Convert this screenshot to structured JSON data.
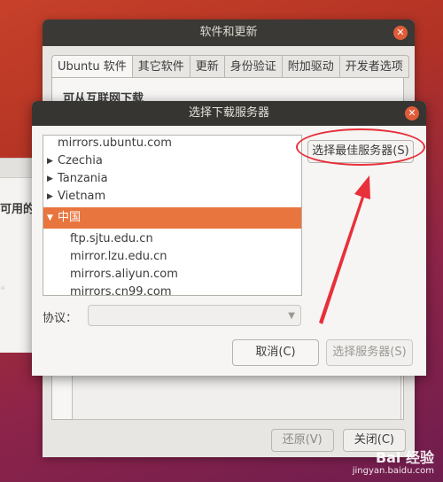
{
  "background_window": {
    "title": "软件和更新",
    "tabs": [
      "Ubuntu 软件",
      "其它软件",
      "更新",
      "身份验证",
      "附加驱动",
      "开发者选项"
    ],
    "section_title": "可从互联网下载",
    "buttons": {
      "revert": "还原(V)",
      "close": "关闭(C)"
    }
  },
  "left_window": {
    "partial_text": "可用的"
  },
  "dialog": {
    "title": "选择下载服务器",
    "list": {
      "top_item": "mirrors.ubuntu.com",
      "countries": [
        "Czechia",
        "Tanzania",
        "Vietnam"
      ],
      "selected_country": "中国",
      "mirrors": [
        "ftp.sjtu.edu.cn",
        "mirror.lzu.edu.cn",
        "mirrors.aliyun.com",
        "mirrors.cn99.com"
      ]
    },
    "best_server_button": "选择最佳服务器(S)",
    "protocol_label": "协议：",
    "protocol_value": "",
    "cancel_button": "取消(C)",
    "select_button": "选择服务器(S)"
  },
  "watermark": {
    "logo": "Bai 经验",
    "url": "jingyan.baidu.com"
  },
  "colors": {
    "selection": "#e9753e",
    "titlebar": "#363532",
    "annotation_red": "#e8303a",
    "close_button": "#e05c38"
  }
}
